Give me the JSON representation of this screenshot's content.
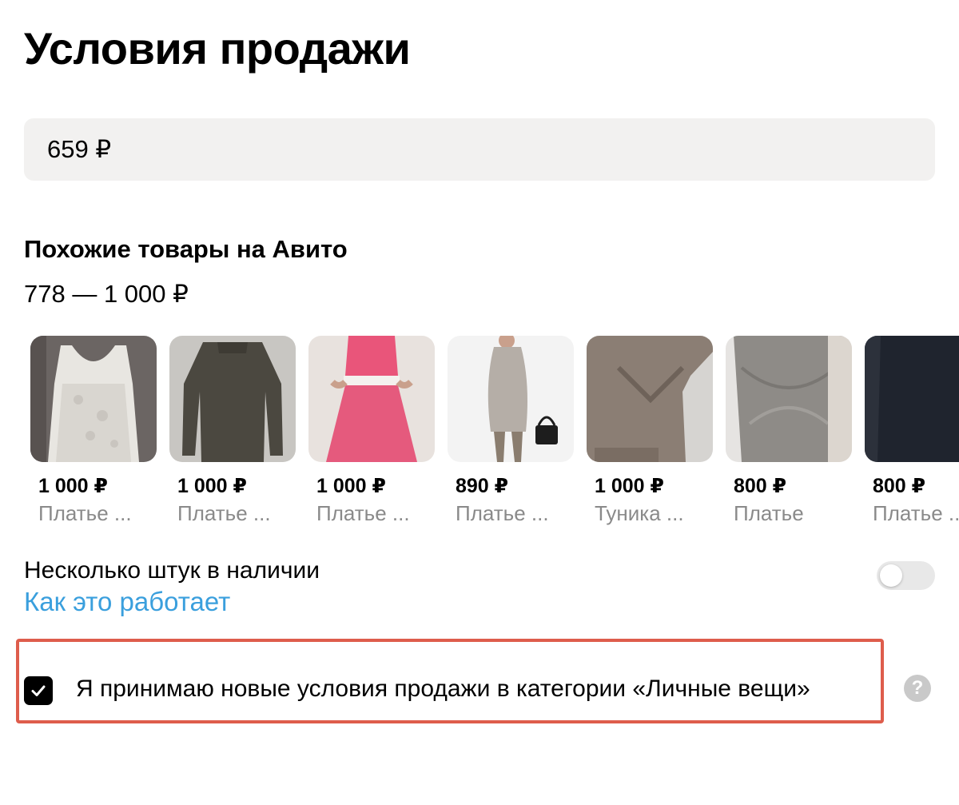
{
  "page": {
    "title": "Условия продажи"
  },
  "price": {
    "value": "659 ₽"
  },
  "similar": {
    "title": "Похожие товары на Авито",
    "range": "778 — 1 000 ₽",
    "items": [
      {
        "price": "1 000 ₽",
        "name": "Платье ..."
      },
      {
        "price": "1 000 ₽",
        "name": "Платье ..."
      },
      {
        "price": "1 000 ₽",
        "name": "Платье ..."
      },
      {
        "price": "890 ₽",
        "name": "Платье ..."
      },
      {
        "price": "1 000 ₽",
        "name": "Туника ..."
      },
      {
        "price": "800 ₽",
        "name": "Платье"
      },
      {
        "price": "800 ₽",
        "name": "Платье ..."
      }
    ]
  },
  "stock": {
    "label": "Несколько штук в наличии",
    "link": "Как это работает",
    "enabled": false
  },
  "terms": {
    "label": "Я принимаю новые условия продажи в категории «Личные вещи»",
    "checked": true
  },
  "help": {
    "icon": "question-icon",
    "glyph": "?"
  },
  "colors": {
    "link": "#3a9fdd",
    "highlight": "#de5d4c",
    "field_bg": "#f2f1f0",
    "muted": "#8a8a8a"
  }
}
